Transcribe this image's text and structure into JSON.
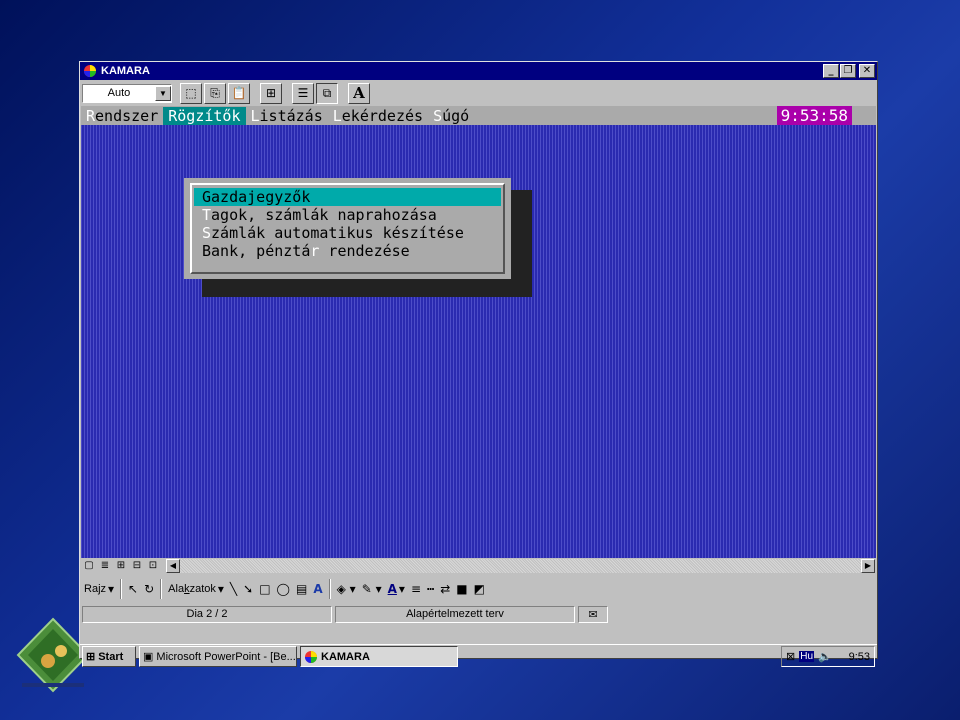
{
  "window": {
    "title": "KAMARA",
    "controls": [
      "_",
      "❐",
      "✕"
    ]
  },
  "toolbar": {
    "font_select_value": "Auto"
  },
  "dos_app": {
    "menu": [
      {
        "hotkey": "R",
        "rest": "endszer"
      },
      {
        "hotkey": "R",
        "rest": "ögzítők"
      },
      {
        "hotkey": "L",
        "rest": "istázás"
      },
      {
        "hotkey": "L",
        "rest": "ekérdezés"
      },
      {
        "hotkey": "S",
        "rest": "úgó"
      }
    ],
    "clock": "9:53:58",
    "dropdown": [
      {
        "before": "Gazdajegyzők",
        "hotkey": "",
        "after": ""
      },
      {
        "before": "",
        "hotkey": "T",
        "after": "agok, számlák naprahozása"
      },
      {
        "before": "",
        "hotkey": "S",
        "after": "zámlák automatikus készítése"
      },
      {
        "before": "Bank, pénztá",
        "hotkey": "r",
        "after": " rendezése"
      }
    ]
  },
  "draw_toolbar": {
    "draw_label_pre": "Ra",
    "draw_label_ul": "j",
    "draw_label_post": "z",
    "shapes_label_pre": "Ala",
    "shapes_label_ul": "k",
    "shapes_label_post": "zatok"
  },
  "status": {
    "slide": "Dia 2 / 2",
    "design": "Alapértelmezett terv"
  },
  "taskbar": {
    "start": "Start",
    "task1": "Microsoft PowerPoint - [Be...",
    "task2": "KAMARA",
    "lang": "Hu",
    "clock": "9:53"
  },
  "colors": {
    "dos_background": "#2a2ab0",
    "dos_menubar": "#aaaaaa",
    "dos_active_menu": "#008a8a",
    "dos_clock": "#aa00aa",
    "dropdown_selected": "#00aaaa",
    "titlebar": "#000080"
  }
}
